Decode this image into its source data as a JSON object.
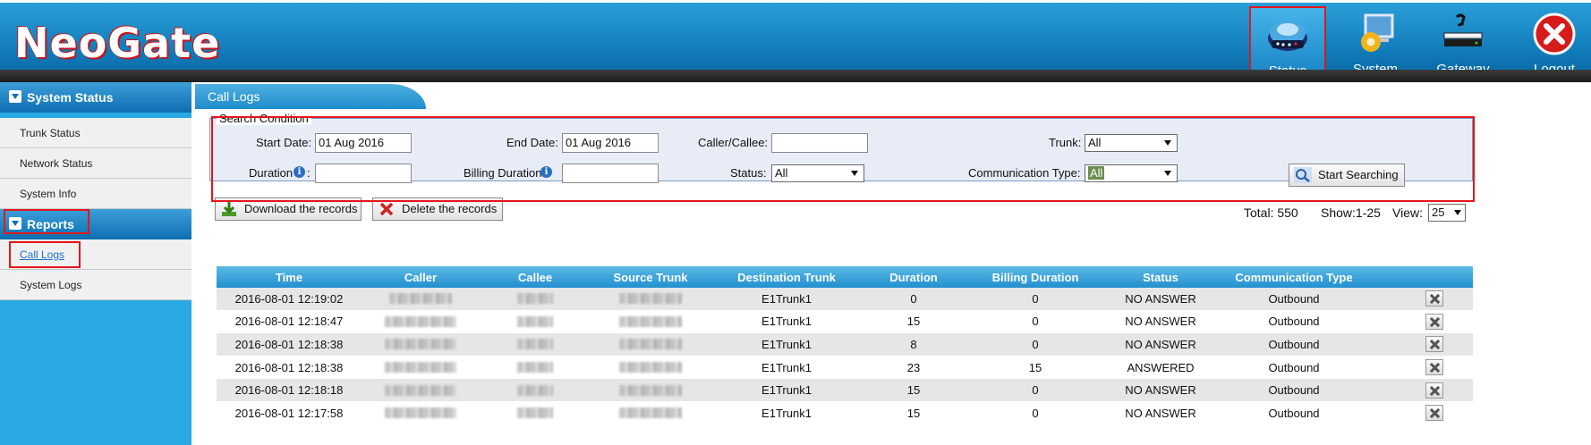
{
  "app": {
    "logo": "NeoGate"
  },
  "topnav": [
    {
      "label": "Status",
      "icon": "status-icon",
      "active": true
    },
    {
      "label": "System",
      "icon": "system-icon",
      "active": false
    },
    {
      "label": "Gateway",
      "icon": "gateway-icon",
      "active": false
    },
    {
      "label": "Logout",
      "icon": "logout-icon",
      "active": false
    }
  ],
  "sidebar": {
    "sections": [
      {
        "title": "System Status",
        "items": [
          "Trunk Status",
          "Network Status",
          "System Info"
        ]
      },
      {
        "title": "Reports",
        "items": [
          "Call Logs",
          "System Logs"
        ]
      }
    ]
  },
  "page": {
    "tab": "Call Logs"
  },
  "search": {
    "legend": "Search Condition",
    "start_date_label": "Start Date:",
    "start_date": "01 Aug 2016",
    "end_date_label": "End Date:",
    "end_date": "01 Aug 2016",
    "caller_label": "Caller/Callee:",
    "caller": "",
    "trunk_label": "Trunk:",
    "trunk": "All",
    "duration_label": "Duration",
    "duration_colon": ":",
    "duration": "",
    "billing_label": "Billing Duration",
    "billing": "",
    "status_label": "Status:",
    "status": "All",
    "comm_label": "Communication Type:",
    "comm": "All",
    "search_button": "Start Searching"
  },
  "actions": {
    "download": "Download the records",
    "delete": "Delete the records"
  },
  "summary": {
    "total": "Total: 550",
    "show": "Show:1-25",
    "view_label": "View:",
    "view_value": "25"
  },
  "table": {
    "headers": [
      "Time",
      "Caller",
      "Callee",
      "Source Trunk",
      "Destination Trunk",
      "Duration",
      "Billing Duration",
      "Status",
      "Communication Type"
    ],
    "rows": [
      {
        "time": "2016-08-01 12:19:02",
        "dest": "E1Trunk1",
        "duration": "0",
        "billing": "0",
        "status": "NO ANSWER",
        "type": "Outbound"
      },
      {
        "time": "2016-08-01 12:18:47",
        "dest": "E1Trunk1",
        "duration": "15",
        "billing": "0",
        "status": "NO ANSWER",
        "type": "Outbound"
      },
      {
        "time": "2016-08-01 12:18:38",
        "dest": "E1Trunk1",
        "duration": "8",
        "billing": "0",
        "status": "NO ANSWER",
        "type": "Outbound"
      },
      {
        "time": "2016-08-01 12:18:38",
        "dest": "E1Trunk1",
        "duration": "23",
        "billing": "15",
        "status": "ANSWERED",
        "type": "Outbound"
      },
      {
        "time": "2016-08-01 12:18:18",
        "dest": "E1Trunk1",
        "duration": "15",
        "billing": "0",
        "status": "NO ANSWER",
        "type": "Outbound"
      },
      {
        "time": "2016-08-01 12:17:58",
        "dest": "E1Trunk1",
        "duration": "15",
        "billing": "0",
        "status": "NO ANSWER",
        "type": "Outbound"
      }
    ]
  }
}
